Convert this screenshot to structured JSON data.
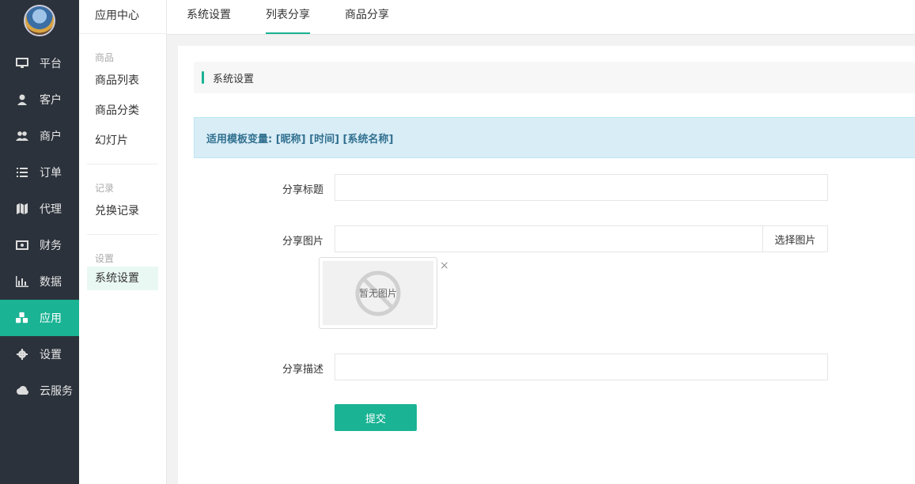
{
  "sidebar": {
    "items": [
      {
        "label": "平台",
        "icon": "monitor-icon"
      },
      {
        "label": "客户",
        "icon": "user-icon"
      },
      {
        "label": "商户",
        "icon": "users-icon"
      },
      {
        "label": "订单",
        "icon": "list-icon"
      },
      {
        "label": "代理",
        "icon": "map-icon"
      },
      {
        "label": "财务",
        "icon": "money-icon"
      },
      {
        "label": "数据",
        "icon": "bar-chart-icon"
      },
      {
        "label": "应用",
        "icon": "cubes-icon",
        "active": true
      },
      {
        "label": "设置",
        "icon": "gear-icon"
      },
      {
        "label": "云服务",
        "icon": "cloud-icon"
      }
    ],
    "accent": "#1ab394",
    "background": "#2b323b"
  },
  "subnav": {
    "title": "应用中心",
    "groups": [
      {
        "label": "商品",
        "items": [
          "商品列表",
          "商品分类",
          "幻灯片"
        ]
      },
      {
        "label": "记录",
        "items": [
          "兑换记录"
        ]
      },
      {
        "label": "设置",
        "items": [
          "系统设置"
        ]
      }
    ]
  },
  "tabs": [
    "系统设置",
    "列表分享",
    "商品分享"
  ],
  "active_tab": "列表分享",
  "panel": {
    "title": "系统设置",
    "alert": "适用模板变量: [昵称] [时间] [系统名称]"
  },
  "form": {
    "share_title_label": "分享标题",
    "share_title_value": "",
    "share_image_label": "分享图片",
    "share_image_value": "",
    "choose_image_label": "选择图片",
    "no_image_text": "暂无图片",
    "close_symbol": "×",
    "share_desc_label": "分享描述",
    "share_desc_value": "",
    "submit_label": "提交"
  }
}
